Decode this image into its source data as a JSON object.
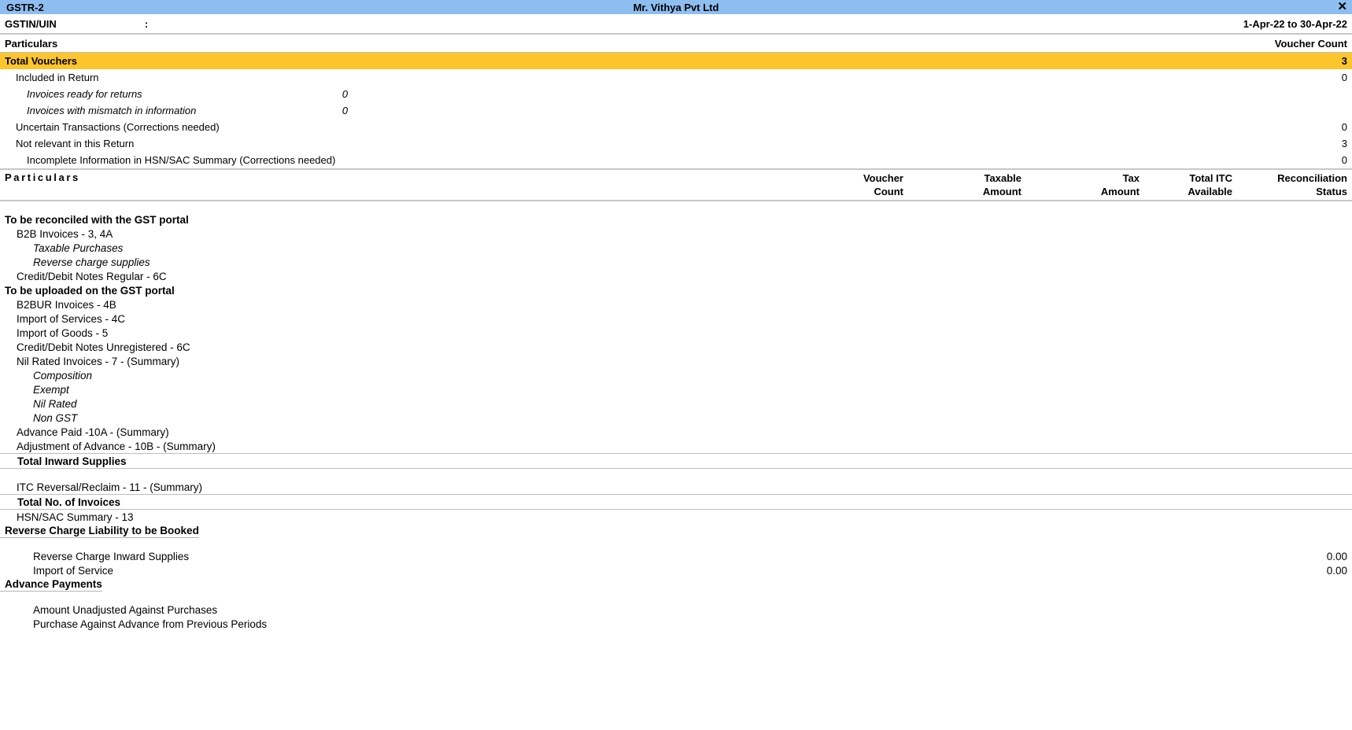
{
  "titlebar": {
    "report_name": "GSTR-2",
    "company": "Mr. Vithya Pvt Ltd",
    "close_glyph": "✕"
  },
  "subheader": {
    "gstin_label": "GSTIN/UIN",
    "colon": ":",
    "gstin_value": "",
    "period": "1-Apr-22 to 30-Apr-22"
  },
  "particulars_header": {
    "left": "Particulars",
    "right": "Voucher Count"
  },
  "summary": [
    {
      "label": "Total Vouchers",
      "indent": 0,
      "highlight": true,
      "mid": "",
      "right": "3"
    },
    {
      "label": "Included in Return",
      "indent": 1,
      "highlight": false,
      "mid": "",
      "right": "0"
    },
    {
      "label": "Invoices ready for returns",
      "indent": 2,
      "highlight": false,
      "mid": "0",
      "right": ""
    },
    {
      "label": "Invoices with mismatch in information",
      "indent": 2,
      "highlight": false,
      "mid": "0",
      "right": ""
    },
    {
      "label": "Uncertain Transactions (Corrections needed)",
      "indent": 1,
      "highlight": false,
      "mid": "",
      "right": "0"
    },
    {
      "label": "Not relevant in this Return",
      "indent": 1,
      "highlight": false,
      "mid": "",
      "right": "3"
    },
    {
      "label": "Incomplete Information in HSN/SAC Summary (Corrections needed)",
      "indent": 2,
      "highlight": false,
      "mid": "",
      "right": "0",
      "plain": true
    }
  ],
  "columns": {
    "particulars": "Particulars",
    "voucher_count": "Voucher\nCount",
    "taxable_amount": "Taxable\nAmount",
    "tax_amount": "Tax\nAmount",
    "total_itc_available": "Total ITC\nAvailable",
    "reconciliation_status": "Reconciliation\nStatus"
  },
  "body": [
    {
      "label": "To be reconciled with the GST portal",
      "style": "head",
      "value": ""
    },
    {
      "label": "B2B Invoices - 3, 4A",
      "style": "item",
      "value": ""
    },
    {
      "label": "Taxable Purchases",
      "style": "sub-italic",
      "value": ""
    },
    {
      "label": "Reverse charge supplies",
      "style": "sub-italic",
      "value": ""
    },
    {
      "label": "Credit/Debit Notes Regular - 6C",
      "style": "item",
      "value": ""
    },
    {
      "label": "To be uploaded on the GST portal",
      "style": "head",
      "value": ""
    },
    {
      "label": "B2BUR Invoices - 4B",
      "style": "item",
      "value": ""
    },
    {
      "label": "Import of Services - 4C",
      "style": "item",
      "value": ""
    },
    {
      "label": "Import of Goods - 5",
      "style": "item",
      "value": ""
    },
    {
      "label": "Credit/Debit Notes Unregistered - 6C",
      "style": "item",
      "value": ""
    },
    {
      "label": "Nil Rated Invoices - 7 - (Summary)",
      "style": "item",
      "value": ""
    },
    {
      "label": "Composition",
      "style": "sub-italic",
      "value": ""
    },
    {
      "label": "Exempt",
      "style": "sub-italic",
      "value": ""
    },
    {
      "label": "Nil Rated",
      "style": "sub-italic",
      "value": ""
    },
    {
      "label": "Non GST",
      "style": "sub-italic",
      "value": ""
    },
    {
      "label": "Advance Paid -10A - (Summary)",
      "style": "item",
      "value": ""
    },
    {
      "label": "Adjustment of Advance - 10B - (Summary)",
      "style": "item",
      "value": ""
    },
    {
      "label": "Total Inward Supplies",
      "style": "total",
      "value": ""
    },
    {
      "label": "ITC Reversal/Reclaim - 11 - (Summary)",
      "style": "item",
      "value": ""
    },
    {
      "label": "Total No. of Invoices",
      "style": "total",
      "value": ""
    },
    {
      "label": "HSN/SAC Summary - 13",
      "style": "item",
      "value": ""
    },
    {
      "label": "Reverse Charge Liability to be Booked",
      "style": "head-underline",
      "value": ""
    },
    {
      "label": "Reverse Charge Inward Supplies",
      "style": "sub-plain",
      "value": "0.00"
    },
    {
      "label": "Import of Service",
      "style": "sub-plain",
      "value": "0.00"
    },
    {
      "label": "Advance Payments",
      "style": "head-underline",
      "value": ""
    },
    {
      "label": "Amount Unadjusted Against Purchases",
      "style": "sub-plain",
      "value": ""
    },
    {
      "label": "Purchase Against Advance from Previous Periods",
      "style": "sub-plain",
      "value": ""
    }
  ],
  "colors": {
    "titlebar_bg": "#8ebef0",
    "highlight_bg": "#fcc52c",
    "rule": "#c8c8c8"
  }
}
